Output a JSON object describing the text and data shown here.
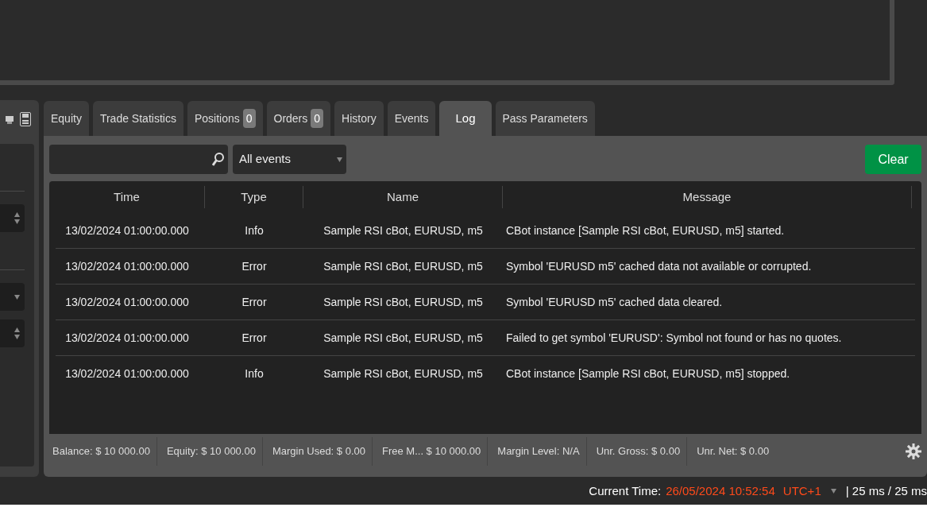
{
  "tabs": [
    {
      "label": "Equity",
      "selected": false
    },
    {
      "label": "Trade Statistics",
      "selected": false
    },
    {
      "label": "Positions",
      "count": "0",
      "selected": false
    },
    {
      "label": "Orders",
      "count": "0",
      "selected": false
    },
    {
      "label": "History",
      "selected": false
    },
    {
      "label": "Events",
      "selected": false
    },
    {
      "label": "Log",
      "selected": true
    },
    {
      "label": "Pass Parameters",
      "selected": false
    }
  ],
  "filter": {
    "dropdown": "All events",
    "clear_button": "Clear"
  },
  "table": {
    "columns": [
      "Time",
      "Type",
      "Name",
      "Message"
    ],
    "rows": [
      {
        "time": "13/02/2024 01:00:00.000",
        "type": "Info",
        "name": "Sample RSI cBot, EURUSD, m5",
        "message": "CBot instance [Sample RSI cBot, EURUSD, m5] started."
      },
      {
        "time": "13/02/2024 01:00:00.000",
        "type": "Error",
        "name": "Sample RSI cBot, EURUSD, m5",
        "message": "Symbol 'EURUSD m5' cached data not available or corrupted."
      },
      {
        "time": "13/02/2024 01:00:00.000",
        "type": "Error",
        "name": "Sample RSI cBot, EURUSD, m5",
        "message": "Symbol 'EURUSD m5' cached data cleared."
      },
      {
        "time": "13/02/2024 01:00:00.000",
        "type": "Error",
        "name": "Sample RSI cBot, EURUSD, m5",
        "message": "Failed to get symbol 'EURUSD': Symbol not found or has no quotes."
      },
      {
        "time": "13/02/2024 01:00:00.000",
        "type": "Info",
        "name": "Sample RSI cBot, EURUSD, m5",
        "message": "CBot instance [Sample RSI cBot, EURUSD, m5] stopped."
      }
    ]
  },
  "summary": [
    {
      "label": "Balance:",
      "value": "$ 10 000.00"
    },
    {
      "label": "Equity:",
      "value": "$ 10 000.00"
    },
    {
      "label": "Margin Used:",
      "value": "$ 0.00"
    },
    {
      "label": "Free M...",
      "value": "$ 10 000.00"
    },
    {
      "label": "Margin Level:",
      "value": "N/A"
    },
    {
      "label": "Unr. Gross:",
      "value": "$ 0.00"
    },
    {
      "label": "Unr. Net:",
      "value": "$ 0.00"
    }
  ],
  "status_bar": {
    "label": "Current Time:",
    "time": "26/05/2024 10:52:54",
    "timezone": "UTC+1",
    "latency": "| 25 ms / 25 ms"
  }
}
